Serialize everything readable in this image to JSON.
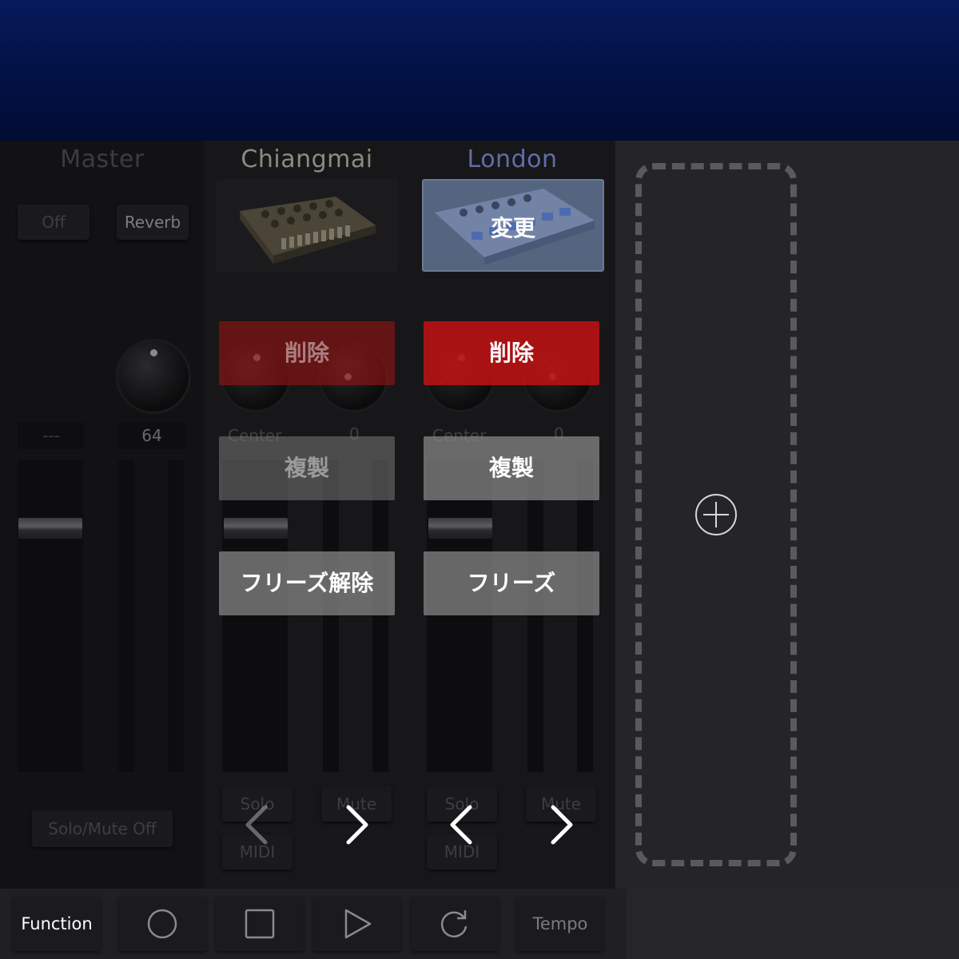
{
  "master": {
    "name": "Master",
    "buttons": {
      "off": "Off",
      "reverb": "Reverb"
    },
    "values": {
      "left": "---",
      "right": "64"
    },
    "solo_mute_off": "Solo/Mute Off"
  },
  "channels": [
    {
      "name": "Chiangmai",
      "pan_label": "Center",
      "pan_value": "0",
      "solo": "Solo",
      "mute": "Mute",
      "midi": "MIDI",
      "actions": {
        "delete": "削除",
        "duplicate": "複製",
        "freeze": "フリーズ解除"
      }
    },
    {
      "name": "London",
      "change": "変更",
      "pan_label": "Center",
      "pan_value": "0",
      "solo": "Solo",
      "mute": "Mute",
      "midi": "MIDI",
      "actions": {
        "delete": "削除",
        "duplicate": "複製",
        "freeze": "フリーズ"
      }
    }
  ],
  "toolbar": {
    "function": "Function",
    "tempo": "Tempo",
    "icons": [
      "record-icon",
      "stop-icon",
      "play-icon",
      "loop-icon"
    ]
  },
  "colors": {
    "topbar": "#031144",
    "delete_red": "#be1212",
    "london_name": "#5f6ea8"
  }
}
